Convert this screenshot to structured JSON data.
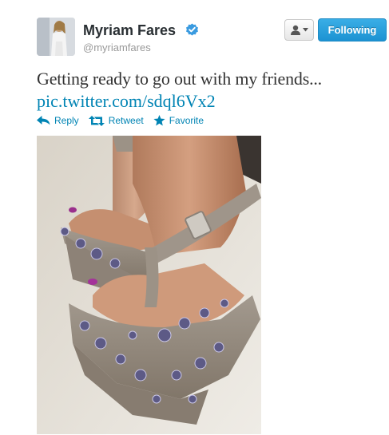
{
  "profile": {
    "name": "Myriam Fares",
    "handle": "@myriamfares"
  },
  "header": {
    "follow_label": "Following"
  },
  "tweet": {
    "text": "Getting ready to go out with my friends...",
    "link": "pic.twitter.com/sdql6Vx2"
  },
  "actions": {
    "reply": "Reply",
    "retweet": "Retweet",
    "favorite": "Favorite"
  },
  "colors": {
    "link": "#0084b4",
    "follow_button": "#2aa3e0",
    "verified": "#3a9be0"
  },
  "icons": [
    "verified-badge-icon",
    "user-icon",
    "caret-down-icon",
    "reply-icon",
    "retweet-icon",
    "star-icon"
  ]
}
